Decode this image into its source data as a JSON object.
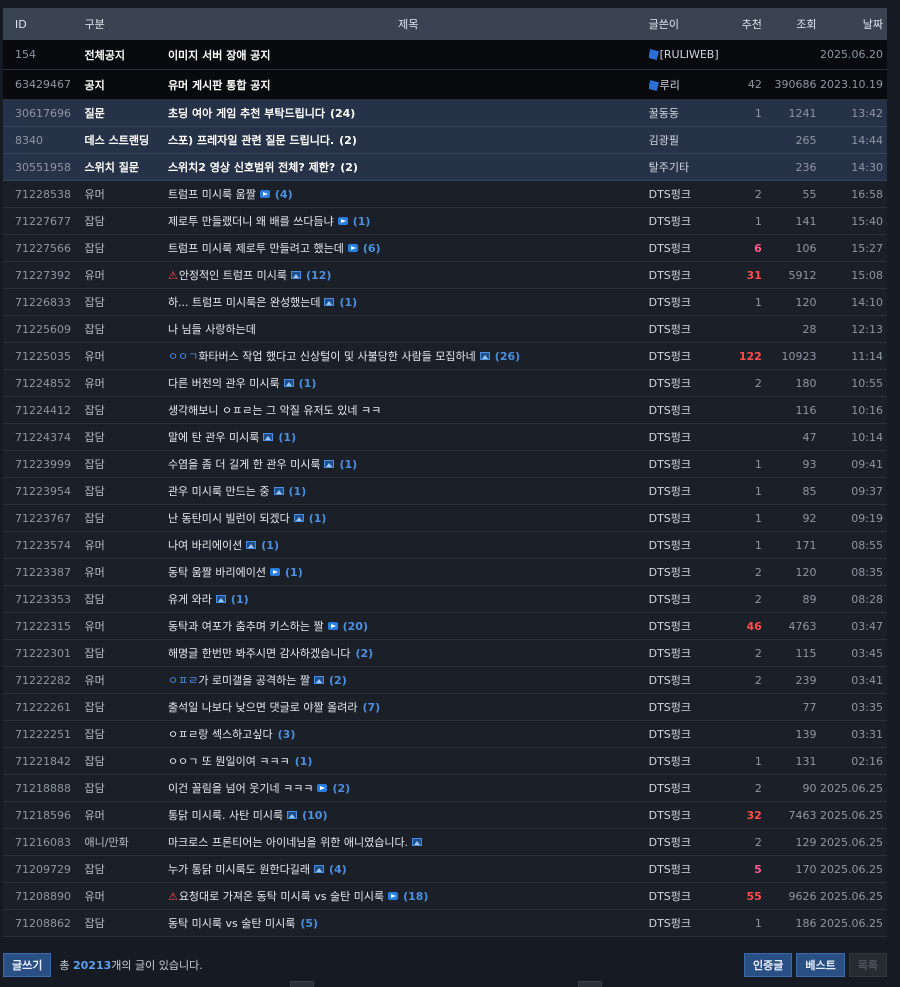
{
  "header": {
    "id": "ID",
    "category": "구분",
    "title": "제목",
    "writer": "글쓴이",
    "recommend": "추천",
    "views": "조회",
    "date": "날짜"
  },
  "rows": [
    {
      "type": "notice",
      "id": "154",
      "category": "전체공지",
      "title": "이미지 서버 장애 공지",
      "writer": "[RULIWEB]",
      "writer_icon": "cube-icon",
      "recommend": "",
      "views": "",
      "date": "2025.06.20"
    },
    {
      "type": "notice",
      "id": "63429467",
      "category": "공지",
      "title": "유머 게시판 통합 공지",
      "writer": "루리",
      "writer_icon": "cube-icon",
      "recommend": "42",
      "views": "390686",
      "date": "2023.10.19"
    },
    {
      "type": "best",
      "id": "30617696",
      "category": "질문",
      "title": "초딩 여아 게임 추천 부탁드립니다",
      "count": "(24)",
      "writer": "꿀동동",
      "recommend": "1",
      "views": "1241",
      "date": "13:42"
    },
    {
      "type": "best",
      "id": "8340",
      "category": "데스 스트랜딩",
      "title": "스포) 프레자일 관련 질문 드립니다.",
      "count": "(2)",
      "writer": "김광필",
      "recommend": "",
      "views": "265",
      "date": "14:44"
    },
    {
      "type": "best",
      "id": "30551958",
      "category": "스위치 질문",
      "title": "스위치2 영상 신호범위 전체? 제한?",
      "count": "(2)",
      "writer": "탈주기타",
      "recommend": "",
      "views": "236",
      "date": "14:30"
    },
    {
      "type": "normal",
      "id": "71228538",
      "category": "유머",
      "title": "트럼프 미시룩 움짤",
      "media": "video",
      "count": "(4)",
      "writer": "DTS펑크",
      "recommend": "2",
      "views": "55",
      "date": "16:58"
    },
    {
      "type": "normal",
      "id": "71227677",
      "category": "잡담",
      "title": "제로투 만들랬더니 왜 배를 쓰다듬냐",
      "media": "video",
      "count": "(1)",
      "writer": "DTS펑크",
      "recommend": "1",
      "views": "141",
      "date": "15:40"
    },
    {
      "type": "normal",
      "id": "71227566",
      "category": "잡담",
      "title": "트럼프 미시룩 제로투 만들려고 했는데",
      "media": "video",
      "count": "(6)",
      "writer": "DTS펑크",
      "recommend": "6",
      "rec_style": "warm",
      "views": "106",
      "date": "15:27"
    },
    {
      "type": "normal",
      "id": "71227392",
      "category": "유머",
      "warn": true,
      "title": "안정적인 트럼프 미시룩",
      "media": "image",
      "count": "(12)",
      "writer": "DTS펑크",
      "recommend": "31",
      "rec_style": "hot",
      "views": "5912",
      "date": "15:08"
    },
    {
      "type": "normal",
      "id": "71226833",
      "category": "잡담",
      "title": "하... 트럼프 미시룩은 완성했는데",
      "media": "image",
      "count": "(1)",
      "writer": "DTS펑크",
      "recommend": "1",
      "views": "120",
      "date": "14:10"
    },
    {
      "type": "normal",
      "id": "71225609",
      "category": "잡담",
      "title": "나 님들 사랑하는데",
      "writer": "DTS펑크",
      "recommend": "",
      "views": "28",
      "date": "12:13"
    },
    {
      "type": "normal",
      "id": "71225035",
      "category": "유머",
      "prefix": "ㅇㅇㄱ",
      "title": "화타버스 작업 했다고 신상털이 및 사불당한 사람들 모집하네",
      "media": "image",
      "count": "(26)",
      "writer": "DTS펑크",
      "recommend": "122",
      "rec_style": "hot",
      "views": "10923",
      "date": "11:14"
    },
    {
      "type": "normal",
      "id": "71224852",
      "category": "유머",
      "title": "다른 버전의 관우 미시룩",
      "media": "image",
      "count": "(1)",
      "writer": "DTS펑크",
      "recommend": "2",
      "views": "180",
      "date": "10:55"
    },
    {
      "type": "normal",
      "id": "71224412",
      "category": "잡담",
      "title": "생각해보니 ㅇㅍㄹ는 그 악질 유저도 있네 ㅋㅋ",
      "writer": "DTS펑크",
      "recommend": "",
      "views": "116",
      "date": "10:16"
    },
    {
      "type": "normal",
      "id": "71224374",
      "category": "잡담",
      "title": "말에 탄 관우 미시룩",
      "media": "image",
      "count": "(1)",
      "writer": "DTS펑크",
      "recommend": "",
      "views": "47",
      "date": "10:14"
    },
    {
      "type": "normal",
      "id": "71223999",
      "category": "잡담",
      "title": "수염을 좀 더 길게 한 관우 미시룩",
      "media": "image",
      "count": "(1)",
      "writer": "DTS펑크",
      "recommend": "1",
      "views": "93",
      "date": "09:41"
    },
    {
      "type": "normal",
      "id": "71223954",
      "category": "잡담",
      "title": "관우 미시룩 만드는 중",
      "media": "image",
      "count": "(1)",
      "writer": "DTS펑크",
      "recommend": "1",
      "views": "85",
      "date": "09:37"
    },
    {
      "type": "normal",
      "id": "71223767",
      "category": "잡담",
      "title": "난 동탄미시 빌런이 되겠다",
      "media": "image",
      "count": "(1)",
      "writer": "DTS펑크",
      "recommend": "1",
      "views": "92",
      "date": "09:19"
    },
    {
      "type": "normal",
      "id": "71223574",
      "category": "유머",
      "title": "나여 바리에이션",
      "media": "image",
      "count": "(1)",
      "writer": "DTS펑크",
      "recommend": "1",
      "views": "171",
      "date": "08:55"
    },
    {
      "type": "normal",
      "id": "71223387",
      "category": "유머",
      "title": "동탁 움짤 바리에이션",
      "media": "video",
      "count": "(1)",
      "writer": "DTS펑크",
      "recommend": "2",
      "views": "120",
      "date": "08:35"
    },
    {
      "type": "normal",
      "id": "71223353",
      "category": "잡담",
      "title": "유게 와라",
      "media": "image",
      "count": "(1)",
      "writer": "DTS펑크",
      "recommend": "2",
      "views": "89",
      "date": "08:28"
    },
    {
      "type": "normal",
      "id": "71222315",
      "category": "유머",
      "title": "동탁과 여포가 춤추며 키스하는 짤",
      "media": "video",
      "count": "(20)",
      "writer": "DTS펑크",
      "recommend": "46",
      "rec_style": "hot",
      "views": "4763",
      "date": "03:47"
    },
    {
      "type": "normal",
      "id": "71222301",
      "category": "잡담",
      "title": "해명글 한번만 봐주시면 감사하겠습니다",
      "count": "(2)",
      "writer": "DTS펑크",
      "recommend": "2",
      "views": "115",
      "date": "03:45"
    },
    {
      "type": "normal",
      "id": "71222282",
      "category": "유머",
      "prefix": "ㅇㅍㄹ",
      "title": "가 로미갤을 공격하는 짤",
      "media": "image",
      "count": "(2)",
      "writer": "DTS펑크",
      "recommend": "2",
      "views": "239",
      "date": "03:41"
    },
    {
      "type": "normal",
      "id": "71222261",
      "category": "잡담",
      "title": "출석일 나보다 낮으면 댓글로 야짤 올려라",
      "count": "(7)",
      "writer": "DTS펑크",
      "recommend": "",
      "views": "77",
      "date": "03:35"
    },
    {
      "type": "normal",
      "id": "71222251",
      "category": "잡담",
      "title": "ㅇㅍㄹ랑 섹스하고싶다",
      "count": "(3)",
      "writer": "DTS펑크",
      "recommend": "",
      "views": "139",
      "date": "03:31"
    },
    {
      "type": "normal",
      "id": "71221842",
      "category": "잡담",
      "title": "ㅇㅇㄱ 또 뭔일이여 ㅋㅋㅋ",
      "count": "(1)",
      "writer": "DTS펑크",
      "recommend": "1",
      "views": "131",
      "date": "02:16"
    },
    {
      "type": "normal",
      "id": "71218888",
      "category": "잡담",
      "title": "이건 꼴림을 넘어 웃기네 ㅋㅋㅋ",
      "media": "video",
      "count": "(2)",
      "writer": "DTS펑크",
      "recommend": "2",
      "views": "90",
      "date": "2025.06.25"
    },
    {
      "type": "normal",
      "id": "71218596",
      "category": "유머",
      "title": "통닭 미시룩. 사탄 미시룩",
      "media": "image",
      "count": "(10)",
      "writer": "DTS펑크",
      "recommend": "32",
      "rec_style": "hot",
      "views": "7463",
      "date": "2025.06.25"
    },
    {
      "type": "normal",
      "id": "71216083",
      "category": "애니/만화",
      "title": "마크로스 프론티어는 아이네님을 위한 애니였습니다.",
      "media": "image",
      "writer": "DTS펑크",
      "recommend": "2",
      "views": "129",
      "date": "2025.06.25"
    },
    {
      "type": "normal",
      "id": "71209729",
      "category": "잡담",
      "title": "누가 통닭 미시룩도 원한다길래",
      "media": "image",
      "count": "(4)",
      "writer": "DTS펑크",
      "recommend": "5",
      "rec_style": "warm",
      "views": "170",
      "date": "2025.06.25"
    },
    {
      "type": "normal",
      "id": "71208890",
      "category": "유머",
      "warn": true,
      "title": "요청대로 가져온 동탁 미시룩 vs 술탄 미시룩",
      "media": "video",
      "count": "(18)",
      "writer": "DTS펑크",
      "recommend": "55",
      "rec_style": "hot",
      "views": "9626",
      "date": "2025.06.25"
    },
    {
      "type": "normal",
      "id": "71208862",
      "category": "잡담",
      "title": "동탁 미시룩 vs 술탄 미시룩",
      "count": "(5)",
      "writer": "DTS펑크",
      "recommend": "1",
      "views": "186",
      "date": "2025.06.25"
    }
  ],
  "footer": {
    "write_label": "글쓰기",
    "total_prefix": "총",
    "total_count": "20213",
    "total_suffix": "개의 글이 있습니다.",
    "certified_label": "인증글",
    "best_label": "베스트",
    "list_label": "목록"
  },
  "colors": {
    "accent": "#2a4f84",
    "hot": "#ff4b4b",
    "warm": "#ff5a8a",
    "link_count": "#4a8fe0"
  }
}
